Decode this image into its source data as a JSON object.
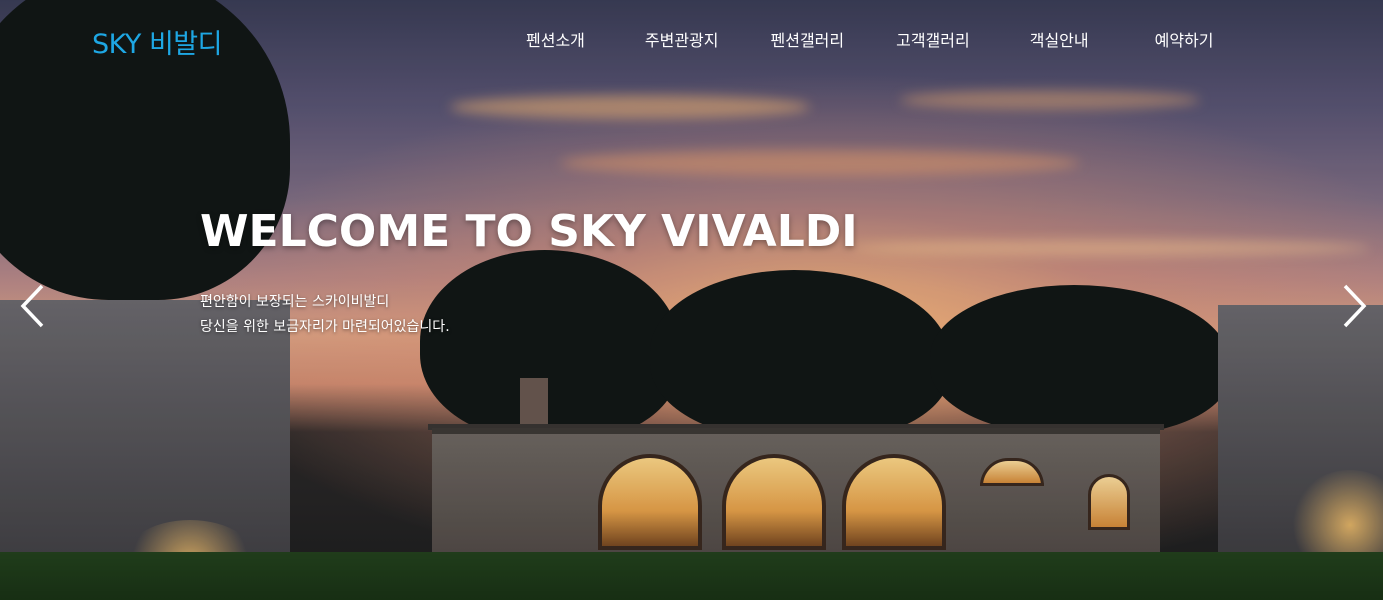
{
  "header": {
    "logo": "SKY 비발디",
    "nav": [
      "펜션소개",
      "주변관광지",
      "펜션갤러리",
      "고객갤러리",
      "객실안내",
      "예약하기"
    ]
  },
  "hero": {
    "headline": "WELCOME TO SKY VIVALDI",
    "subtitle_line1": "편안함이 보장되는 스카이비발디",
    "subtitle_line2": "당신을 위한 보금자리가 마련되어있습니다."
  },
  "slider": {
    "prev_icon": "chevron-left-icon",
    "next_icon": "chevron-right-icon"
  },
  "colors": {
    "logo": "#1ea7e4",
    "nav_text": "#ffffff",
    "headline": "#ffffff"
  }
}
